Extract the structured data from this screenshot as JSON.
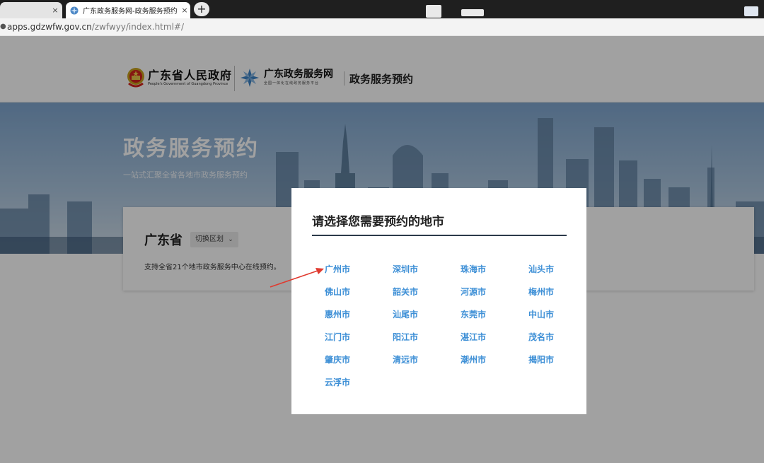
{
  "browser": {
    "tabs": [
      {
        "title": "",
        "active": false,
        "close": "×"
      },
      {
        "title": "广东政务服务网-政务服务预约",
        "active": true,
        "close": "×"
      }
    ],
    "new_tab_label": "+",
    "address": {
      "host": "apps.gdzwfw.gov.cn",
      "path": "/zwfwyy/index.html#/"
    }
  },
  "header": {
    "gov_name": "广东省人民政府",
    "gov_name_en": "People's Government of Guangdong Province",
    "portal_name": "广东政务服务网",
    "portal_sub": "全国一体化在线政务服务平台",
    "service_name": "政务服务预约"
  },
  "banner": {
    "title": "政务服务预约",
    "subtitle": "一站式汇聚全省各地市政务服务预约"
  },
  "region_card": {
    "title": "广东省",
    "switch_label": "切换区划",
    "switch_icon": "chevron-down-icon",
    "description": "支持全省21个地市政务服务中心在线预约。"
  },
  "modal": {
    "title": "请选择您需要预约的地市",
    "cities": [
      "广州市",
      "深圳市",
      "珠海市",
      "汕头市",
      "佛山市",
      "韶关市",
      "河源市",
      "梅州市",
      "惠州市",
      "汕尾市",
      "东莞市",
      "中山市",
      "江门市",
      "阳江市",
      "湛江市",
      "茂名市",
      "肇庆市",
      "清远市",
      "潮州市",
      "揭阳市",
      "云浮市"
    ]
  },
  "colors": {
    "city_link": "#3d8fd6",
    "annotation_arrow": "#e03a2f",
    "modal_rule": "#2c3a4a",
    "overlay": "rgba(0,0,0,0.37)"
  }
}
